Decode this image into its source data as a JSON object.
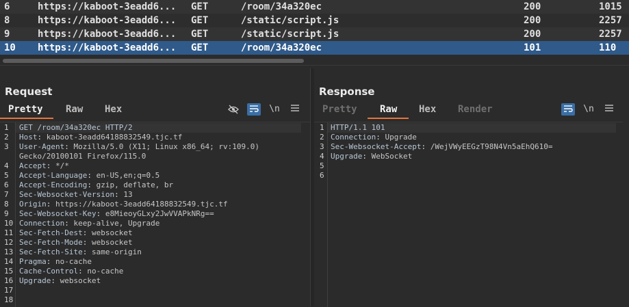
{
  "traffic": {
    "rows": [
      {
        "num": "6",
        "host": "https://kaboot-3eadd6...",
        "method": "GET",
        "path": "/room/34a320ec",
        "status": "200",
        "length": "1015"
      },
      {
        "num": "8",
        "host": "https://kaboot-3eadd6...",
        "method": "GET",
        "path": "/static/script.js",
        "status": "200",
        "length": "2257"
      },
      {
        "num": "9",
        "host": "https://kaboot-3eadd6...",
        "method": "GET",
        "path": "/static/script.js",
        "status": "200",
        "length": "2257"
      },
      {
        "num": "10",
        "host": "https://kaboot-3eadd6...",
        "method": "GET",
        "path": "/room/34a320ec",
        "status": "101",
        "length": "110"
      }
    ],
    "selected_row": "10"
  },
  "request": {
    "title": "Request",
    "tabs": {
      "pretty": "Pretty",
      "raw": "Raw",
      "hex": "Hex"
    },
    "active_tab": "Pretty",
    "toolbar": {
      "hide_icon": "eye-slash-icon",
      "wrap_icon": "wrap-icon",
      "newline": "\\n",
      "menu_icon": "hamburger-icon"
    },
    "line_numbers": [
      "1",
      "2",
      "3",
      "",
      "4",
      "5",
      "6",
      "7",
      "8",
      "9",
      "10",
      "11",
      "12",
      "13",
      "14",
      "15",
      "16",
      "17",
      "18"
    ],
    "lines": [
      {
        "k": "GET /room/34a320ec HTTP/2",
        "v": ""
      },
      {
        "k": "Host",
        "v": "kaboot-3eadd64188832549.tjc.tf"
      },
      {
        "k": "User-Agent",
        "v": "Mozilla/5.0 (X11; Linux x86_64; rv:109.0)"
      },
      {
        "k": "",
        "v": "Gecko/20100101 Firefox/115.0"
      },
      {
        "k": "Accept",
        "v": "*/*"
      },
      {
        "k": "Accept-Language",
        "v": "en-US,en;q=0.5"
      },
      {
        "k": "Accept-Encoding",
        "v": "gzip, deflate, br"
      },
      {
        "k": "Sec-Websocket-Version",
        "v": "13"
      },
      {
        "k": "Origin",
        "v": "https://kaboot-3eadd64188832549.tjc.tf"
      },
      {
        "k": "Sec-Websocket-Key",
        "v": "e8MieoyGLxy2JwVVAPkNRg=="
      },
      {
        "k": "Connection",
        "v": "keep-alive, Upgrade"
      },
      {
        "k": "Sec-Fetch-Dest",
        "v": "websocket"
      },
      {
        "k": "Sec-Fetch-Mode",
        "v": "websocket"
      },
      {
        "k": "Sec-Fetch-Site",
        "v": "same-origin"
      },
      {
        "k": "Pragma",
        "v": "no-cache"
      },
      {
        "k": "Cache-Control",
        "v": "no-cache"
      },
      {
        "k": "Upgrade",
        "v": "websocket"
      },
      {
        "k": "",
        "v": ""
      },
      {
        "k": "",
        "v": ""
      }
    ]
  },
  "response": {
    "title": "Response",
    "tabs": {
      "pretty": "Pretty",
      "raw": "Raw",
      "hex": "Hex",
      "render": "Render"
    },
    "active_tab": "Raw",
    "toolbar": {
      "wrap_icon": "wrap-icon",
      "newline": "\\n",
      "menu_icon": "hamburger-icon"
    },
    "line_numbers": [
      "1",
      "2",
      "3",
      "4",
      "5",
      "6"
    ],
    "lines": [
      {
        "k": "HTTP/1.1 101",
        "v": ""
      },
      {
        "k": "Connection",
        "v": "Upgrade"
      },
      {
        "k": "Sec-Websocket-Accept",
        "v": "/WejVWyEEGzT98N4Vn5aEhQ610="
      },
      {
        "k": "Upgrade",
        "v": "WebSocket"
      },
      {
        "k": "",
        "v": ""
      },
      {
        "k": "",
        "v": ""
      }
    ]
  },
  "layout_buttons": [
    "side-by-side-icon",
    "stacked-icon",
    "single-pane-icon"
  ],
  "colors": {
    "accent": "#e8743c",
    "selected_row": "#2f5a8a",
    "toggle_on": "#3a6ea5"
  }
}
